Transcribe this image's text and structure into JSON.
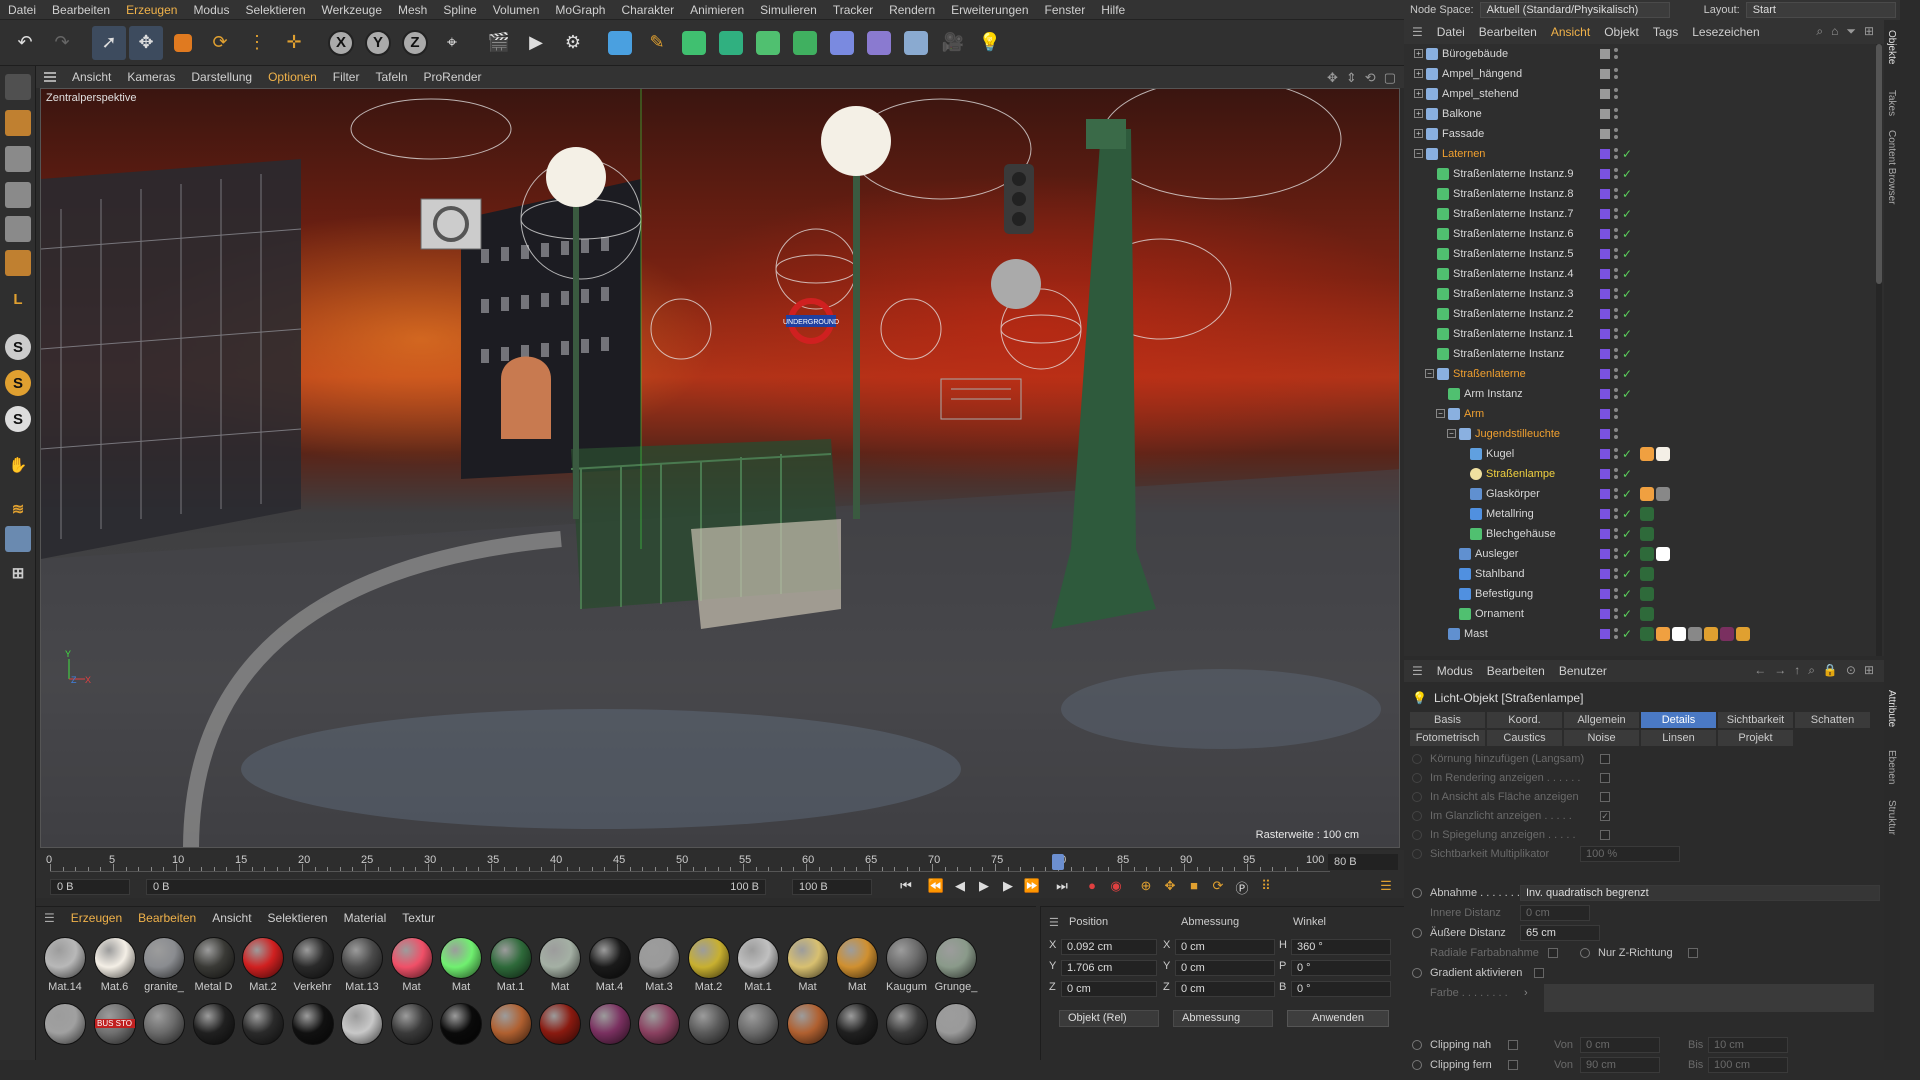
{
  "menubar": [
    "Datei",
    "Bearbeiten",
    "Erzeugen",
    "Modus",
    "Selektieren",
    "Werkzeuge",
    "Mesh",
    "Spline",
    "Volumen",
    "MoGraph",
    "Charakter",
    "Animieren",
    "Simulieren",
    "Tracker",
    "Rendern",
    "Erweiterungen",
    "Fenster",
    "Hilfe"
  ],
  "nodespace": {
    "label": "Node Space:",
    "value": "Aktuell (Standard/Physikalisch)",
    "layout_label": "Layout:",
    "layout_value": "Start"
  },
  "viewport": {
    "menu": [
      "Ansicht",
      "Kameras",
      "Darstellung",
      "Optionen",
      "Filter",
      "Tafeln",
      "ProRender"
    ],
    "camera_label": "Zentralperspektive",
    "raster": "Rasterweite : 100 cm",
    "sign_text": "UNDERGROUND",
    "axis_y": "Y",
    "axis_z": "Z",
    "axis_x": "X"
  },
  "timeline": {
    "ticks": [
      "0",
      "5",
      "10",
      "15",
      "20",
      "25",
      "30",
      "35",
      "40",
      "45",
      "50",
      "55",
      "60",
      "65",
      "70",
      "75",
      "80",
      "85",
      "90",
      "95",
      "100"
    ],
    "current_frame": 80,
    "frame_end": "80 B",
    "start_field": "0 B",
    "min_field": "0 B",
    "max_field": "100 B",
    "end_field": "100 B"
  },
  "materials": {
    "menu": [
      "Erzeugen",
      "Bearbeiten",
      "Ansicht",
      "Selektieren",
      "Material",
      "Textur"
    ],
    "row1": [
      {
        "name": "Mat.14",
        "color": "#b8b8b8"
      },
      {
        "name": "Mat.6",
        "color": "#f4efe6"
      },
      {
        "name": "granite_",
        "color": "#8a8c90"
      },
      {
        "name": "Metal D",
        "color": "#3a3a36"
      },
      {
        "name": "Mat.2",
        "color": "#d02020"
      },
      {
        "name": "Verkehr",
        "color": "#2a2a2a"
      },
      {
        "name": "Mat.13",
        "color": "#4a4a4a"
      },
      {
        "name": "Mat",
        "color": "#f05068"
      },
      {
        "name": "Mat",
        "color": "#70f070"
      },
      {
        "name": "Mat.1",
        "color": "#2e6a3a"
      },
      {
        "name": "Mat",
        "color": "#a4b0a4"
      },
      {
        "name": "Mat.4",
        "color": "#1a1a1a"
      },
      {
        "name": "Mat.3",
        "color": "#9a9a9a"
      },
      {
        "name": "Mat.2",
        "color": "#c8b030"
      },
      {
        "name": "Mat.1",
        "color": "#c0c0c0"
      },
      {
        "name": "Mat",
        "color": "#d8c070"
      },
      {
        "name": "Mat",
        "color": "#d09030"
      },
      {
        "name": "Kaugum",
        "color": "#6a6a6a"
      },
      {
        "name": "Grunge_",
        "color": "#8a9a8a"
      }
    ],
    "row2": [
      "#a0a0a0",
      "#707070",
      "#6a6a6a",
      "#202020",
      "#2a2a2a",
      "#111111",
      "#c8c8c8",
      "#3a3a3a",
      "#0a0a0a",
      "#b06030",
      "#8a1a10",
      "#7a3060",
      "#8a4060",
      "#5a5a5a",
      "#6a6a6a",
      "#b06030",
      "#202020",
      "#3a3a3a",
      "#9a9a9a"
    ],
    "logo_text": "BUS STO"
  },
  "coords": {
    "head_position": "Position",
    "head_size": "Abmessung",
    "head_angle": "Winkel",
    "rows": [
      {
        "axis": "X",
        "pos": "0.092 cm",
        "s_axis": "X",
        "size": "0 cm",
        "r_axis": "H",
        "rot": "360 °"
      },
      {
        "axis": "Y",
        "pos": "1.706 cm",
        "s_axis": "Y",
        "size": "0 cm",
        "r_axis": "P",
        "rot": "0 °"
      },
      {
        "axis": "Z",
        "pos": "0 cm",
        "s_axis": "Z",
        "size": "0 cm",
        "r_axis": "B",
        "rot": "0 °"
      }
    ],
    "mode": "Objekt (Rel)",
    "size_mode": "Abmessung",
    "apply": "Anwenden"
  },
  "objects": {
    "menu": [
      "Datei",
      "Bearbeiten",
      "Ansicht",
      "Objekt",
      "Tags",
      "Lesezeichen"
    ],
    "rows": [
      {
        "name": "Bürogebäude",
        "indent": 0,
        "type": "null",
        "style": ""
      },
      {
        "name": "Ampel_hängend",
        "indent": 0,
        "type": "null",
        "style": ""
      },
      {
        "name": "Ampel_stehend",
        "indent": 0,
        "type": "null",
        "style": ""
      },
      {
        "name": "Balkone",
        "indent": 0,
        "type": "null",
        "style": ""
      },
      {
        "name": "Fassade",
        "indent": 0,
        "type": "null",
        "style": ""
      },
      {
        "name": "Laternen",
        "indent": 0,
        "type": "null",
        "style": "orange"
      },
      {
        "name": "Straßenlaterne Instanz.9",
        "indent": 1,
        "type": "inst",
        "style": ""
      },
      {
        "name": "Straßenlaterne Instanz.8",
        "indent": 1,
        "type": "inst",
        "style": ""
      },
      {
        "name": "Straßenlaterne Instanz.7",
        "indent": 1,
        "type": "inst",
        "style": ""
      },
      {
        "name": "Straßenlaterne Instanz.6",
        "indent": 1,
        "type": "inst",
        "style": ""
      },
      {
        "name": "Straßenlaterne Instanz.5",
        "indent": 1,
        "type": "inst",
        "style": ""
      },
      {
        "name": "Straßenlaterne Instanz.4",
        "indent": 1,
        "type": "inst",
        "style": ""
      },
      {
        "name": "Straßenlaterne Instanz.3",
        "indent": 1,
        "type": "inst",
        "style": ""
      },
      {
        "name": "Straßenlaterne Instanz.2",
        "indent": 1,
        "type": "inst",
        "style": ""
      },
      {
        "name": "Straßenlaterne Instanz.1",
        "indent": 1,
        "type": "inst",
        "style": ""
      },
      {
        "name": "Straßenlaterne Instanz",
        "indent": 1,
        "type": "inst",
        "style": ""
      },
      {
        "name": "Straßenlaterne",
        "indent": 1,
        "type": "null",
        "style": "orange"
      },
      {
        "name": "Arm Instanz",
        "indent": 2,
        "type": "inst",
        "style": ""
      },
      {
        "name": "Arm",
        "indent": 2,
        "type": "null",
        "style": "orange"
      },
      {
        "name": "Jugendstilleuchte",
        "indent": 3,
        "type": "null",
        "style": "orange"
      },
      {
        "name": "Kugel",
        "indent": 4,
        "type": "sphere",
        "style": ""
      },
      {
        "name": "Straßenlampe",
        "indent": 4,
        "type": "light",
        "style": "yellow"
      },
      {
        "name": "Glaskörper",
        "indent": 4,
        "type": "bone",
        "style": ""
      },
      {
        "name": "Metallring",
        "indent": 4,
        "type": "tube",
        "style": ""
      },
      {
        "name": "Blechgehäuse",
        "indent": 4,
        "type": "green",
        "style": ""
      },
      {
        "name": "Ausleger",
        "indent": 3,
        "type": "bone",
        "style": ""
      },
      {
        "name": "Stahlband",
        "indent": 3,
        "type": "tube",
        "style": ""
      },
      {
        "name": "Befestigung",
        "indent": 3,
        "type": "tube",
        "style": ""
      },
      {
        "name": "Ornament",
        "indent": 3,
        "type": "green",
        "style": ""
      },
      {
        "name": "Mast",
        "indent": 2,
        "type": "bone",
        "style": ""
      }
    ]
  },
  "attributes": {
    "menu": [
      "Modus",
      "Bearbeiten",
      "Benutzer"
    ],
    "title": "Licht-Objekt [Straßenlampe]",
    "tabs_row1": [
      "Basis",
      "Koord.",
      "Allgemein",
      "Details",
      "Sichtbarkeit",
      "Schatten"
    ],
    "tabs_row2": [
      "Fotometrisch",
      "Caustics",
      "Noise",
      "Linsen",
      "Projekt"
    ],
    "active_tab": "Details",
    "rows": [
      {
        "label": "Körnung hinzufügen (Langsam)",
        "dim": true
      },
      {
        "label": "Im Rendering anzeigen . . . . . .",
        "dim": true
      },
      {
        "label": "In Ansicht als Fläche anzeigen",
        "dim": true
      },
      {
        "label": "Im Glanzlicht anzeigen . . . . .",
        "dim": true
      },
      {
        "label": "In Spiegelung anzeigen . . . . .",
        "dim": true
      },
      {
        "label": "Sichtbarkeit Multiplikator",
        "dim": true,
        "value": "100 %"
      }
    ],
    "falloff_label": "Abnahme . . . . . . .",
    "falloff_value": "Inv. quadratisch begrenzt",
    "inner_label": "Innere Distanz",
    "inner_value": "0 cm",
    "outer_label": "Äußere Distanz",
    "outer_value": "65 cm",
    "radial_label": "Radiale Farbabnahme",
    "zdir_label": "Nur Z-Richtung",
    "gradient_label": "Gradient aktivieren",
    "color_label": "Farbe . . . . . . . .",
    "clip_near_label": "Clipping nah",
    "clip_far_label": "Clipping fern",
    "from_label": "Von",
    "to_label": "Bis",
    "clip_near_from": "0 cm",
    "clip_near_to": "10 cm",
    "clip_far_from": "90 cm",
    "clip_far_to": "100 cm"
  },
  "side_tabs": [
    "Objekte",
    "Takes",
    "Content Browser",
    "Attribute",
    "Ebenen",
    "Struktur"
  ]
}
